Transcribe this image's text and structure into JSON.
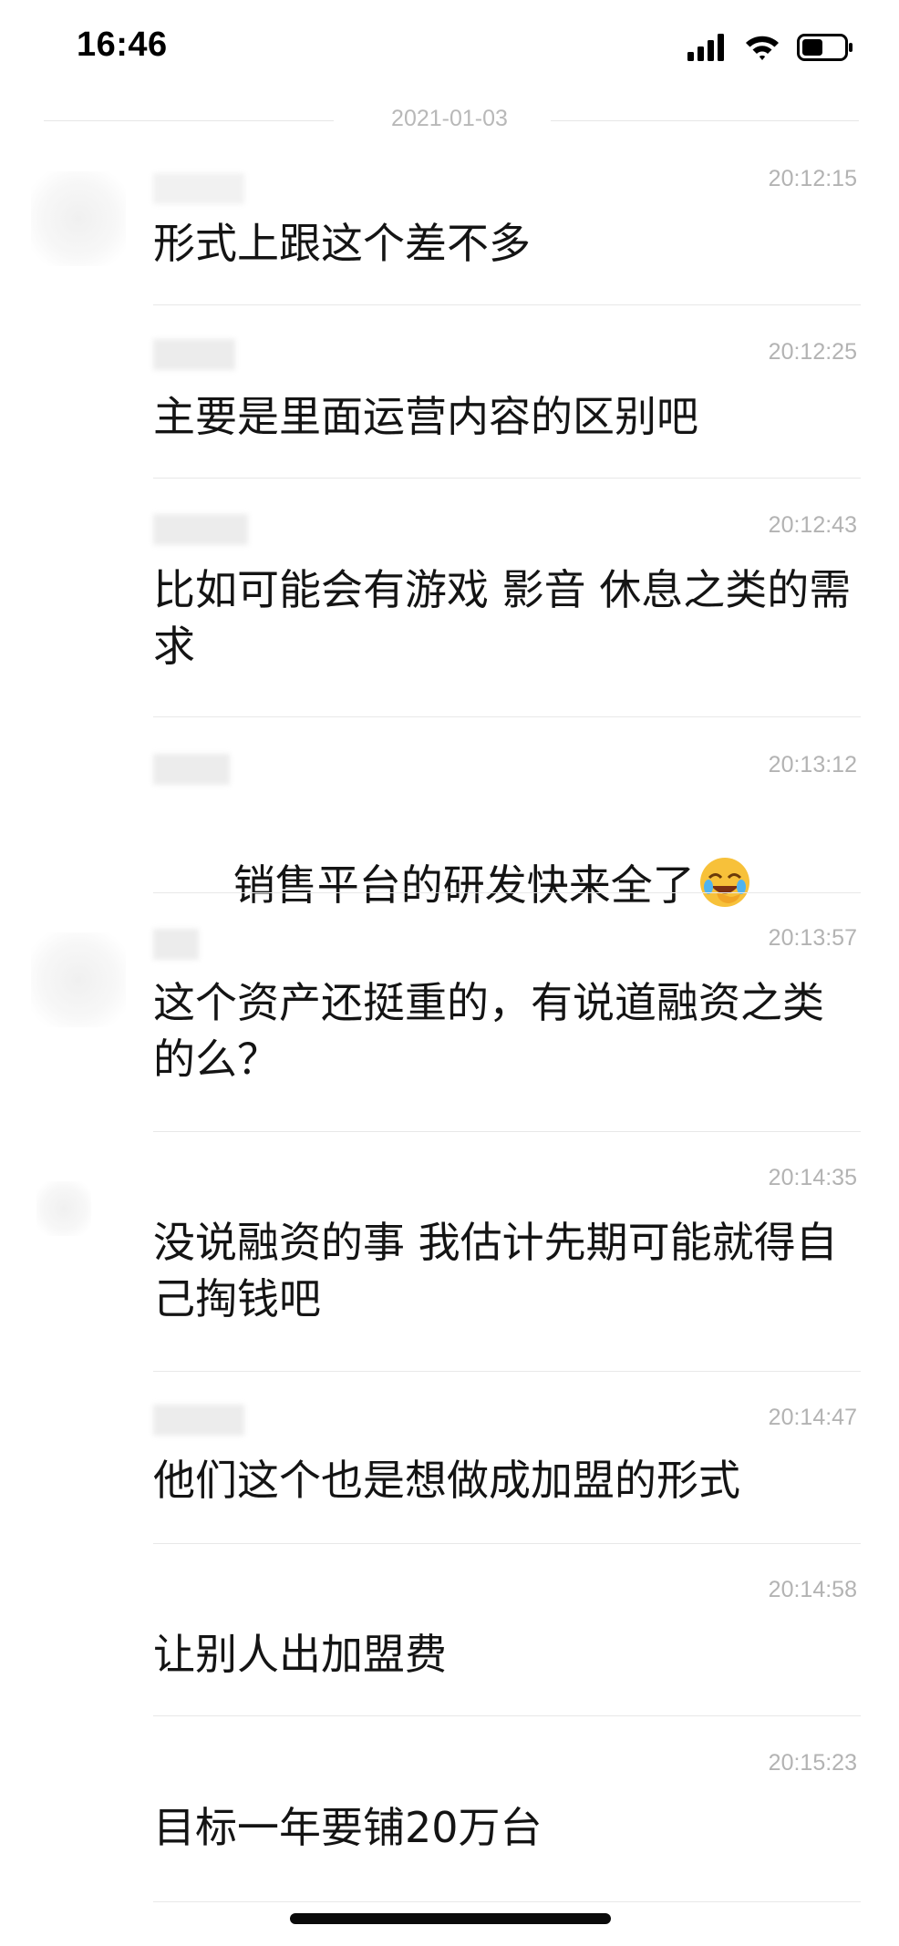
{
  "status_bar": {
    "time": "16:46",
    "icons": [
      "cellular-signal-icon",
      "wifi-icon",
      "battery-icon"
    ]
  },
  "date_divider": "2021-01-03",
  "messages": [
    {
      "time": "20:12:15",
      "text": "形式上跟这个差不多"
    },
    {
      "time": "20:12:25",
      "text": "主要是里面运营内容的区别吧"
    },
    {
      "time": "20:12:43",
      "text": "比如可能会有游戏 影音 休息之类的需求"
    },
    {
      "time": "20:13:12",
      "text": "销售平台的研发快来全了",
      "emoji": "face-palm-laughing-emoji-icon"
    },
    {
      "time": "20:13:57",
      "text": "这个资产还挺重的，有说道融资之类的么？"
    },
    {
      "time": "20:14:35",
      "text": "没说融资的事 我估计先期可能就得自己掏钱吧"
    },
    {
      "time": "20:14:47",
      "text": "他们这个也是想做成加盟的形式"
    },
    {
      "time": "20:14:58",
      "text": "让别人出加盟费"
    },
    {
      "time": "20:15:23",
      "text": "目标一年要铺20万台"
    }
  ]
}
